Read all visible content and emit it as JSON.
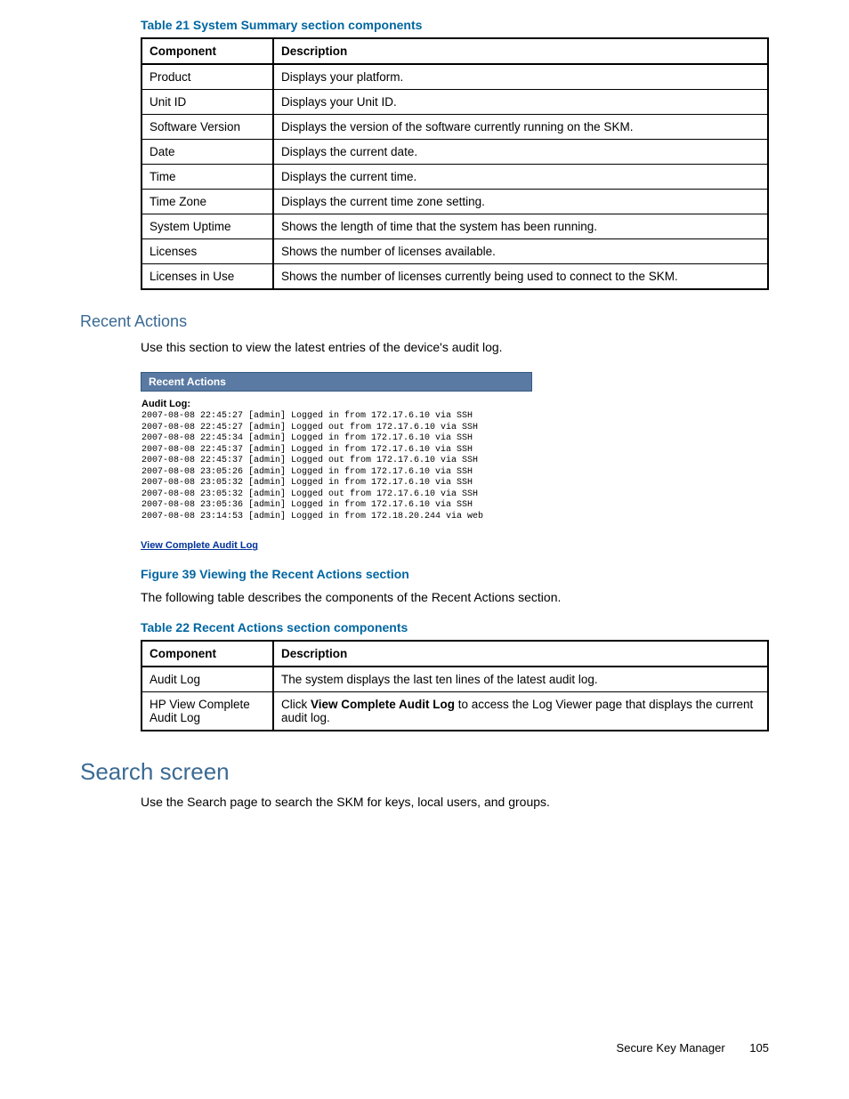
{
  "table21": {
    "caption": "Table 21 System Summary section components",
    "headers": [
      "Component",
      "Description"
    ],
    "rows": [
      [
        "Product",
        "Displays your platform."
      ],
      [
        "Unit ID",
        "Displays your Unit ID."
      ],
      [
        "Software Version",
        "Displays the version of the software currently running on the SKM."
      ],
      [
        "Date",
        "Displays the current date."
      ],
      [
        "Time",
        "Displays the current time."
      ],
      [
        "Time Zone",
        "Displays the current time zone setting."
      ],
      [
        "System Uptime",
        "Shows the length of time that the system has been running."
      ],
      [
        "Licenses",
        "Shows the number of licenses available."
      ],
      [
        "Licenses in Use",
        "Shows the number of licenses currently being used to connect to the SKM."
      ]
    ]
  },
  "recentActions": {
    "heading": "Recent Actions",
    "intro": "Use this section to view the latest entries of the device's audit log.",
    "panelTitle": "Recent Actions",
    "auditLabel": "Audit Log:",
    "auditLines": [
      "2007-08-08 22:45:27 [admin] Logged in from 172.17.6.10 via SSH",
      "2007-08-08 22:45:27 [admin] Logged out from 172.17.6.10 via SSH",
      "2007-08-08 22:45:34 [admin] Logged in from 172.17.6.10 via SSH",
      "2007-08-08 22:45:37 [admin] Logged in from 172.17.6.10 via SSH",
      "2007-08-08 22:45:37 [admin] Logged out from 172.17.6.10 via SSH",
      "2007-08-08 23:05:26 [admin] Logged in from 172.17.6.10 via SSH",
      "2007-08-08 23:05:32 [admin] Logged in from 172.17.6.10 via SSH",
      "2007-08-08 23:05:32 [admin] Logged out from 172.17.6.10 via SSH",
      "2007-08-08 23:05:36 [admin] Logged in from 172.17.6.10 via SSH",
      "2007-08-08 23:14:53 [admin] Logged in from 172.18.20.244 via web"
    ],
    "link": "View Complete Audit Log",
    "figureCaption": "Figure 39 Viewing the Recent Actions section",
    "tableIntro": "The following table describes the components of the Recent Actions section."
  },
  "table22": {
    "caption": "Table 22 Recent Actions section components",
    "headers": [
      "Component",
      "Description"
    ],
    "rows": [
      {
        "c": "Audit Log",
        "d_pre": "The system displays the last ten lines of the latest audit log.",
        "d_bold": "",
        "d_post": ""
      },
      {
        "c": "HP View Complete Audit Log",
        "d_pre": "Click ",
        "d_bold": "View Complete Audit Log",
        "d_post": " to access the Log Viewer page that displays the current audit log."
      }
    ]
  },
  "searchScreen": {
    "heading": "Search screen",
    "intro": "Use the Search page to search the SKM for keys, local users, and groups."
  },
  "footer": {
    "title": "Secure Key Manager",
    "page": "105"
  }
}
